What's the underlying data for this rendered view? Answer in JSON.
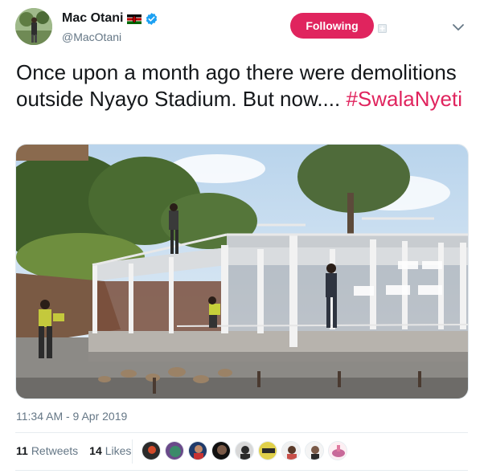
{
  "tweet": {
    "author_name": "Mac Otani",
    "handle": "@MacOtani",
    "follow_label": "Following",
    "text_before": "Once upon a month ago there were demolitions outside Nyayo Stadium. But now.... ",
    "hashtag": "#SwalaNyeti",
    "timestamp": "11:34 AM - 9 Apr 2019",
    "retweets_count": "11",
    "retweets_label": "Retweets",
    "likes_count": "14",
    "likes_label": "Likes"
  },
  "icons": {
    "flag": "kenya-flag-icon",
    "verified": "verified-badge-icon",
    "follow_extra": "follow-icon",
    "more": "chevron-down-icon"
  },
  "colors": {
    "accent": "#e0245e",
    "verified": "#1da1f2",
    "muted": "#657786",
    "text": "#14171a"
  },
  "likers_count_shown": 9
}
